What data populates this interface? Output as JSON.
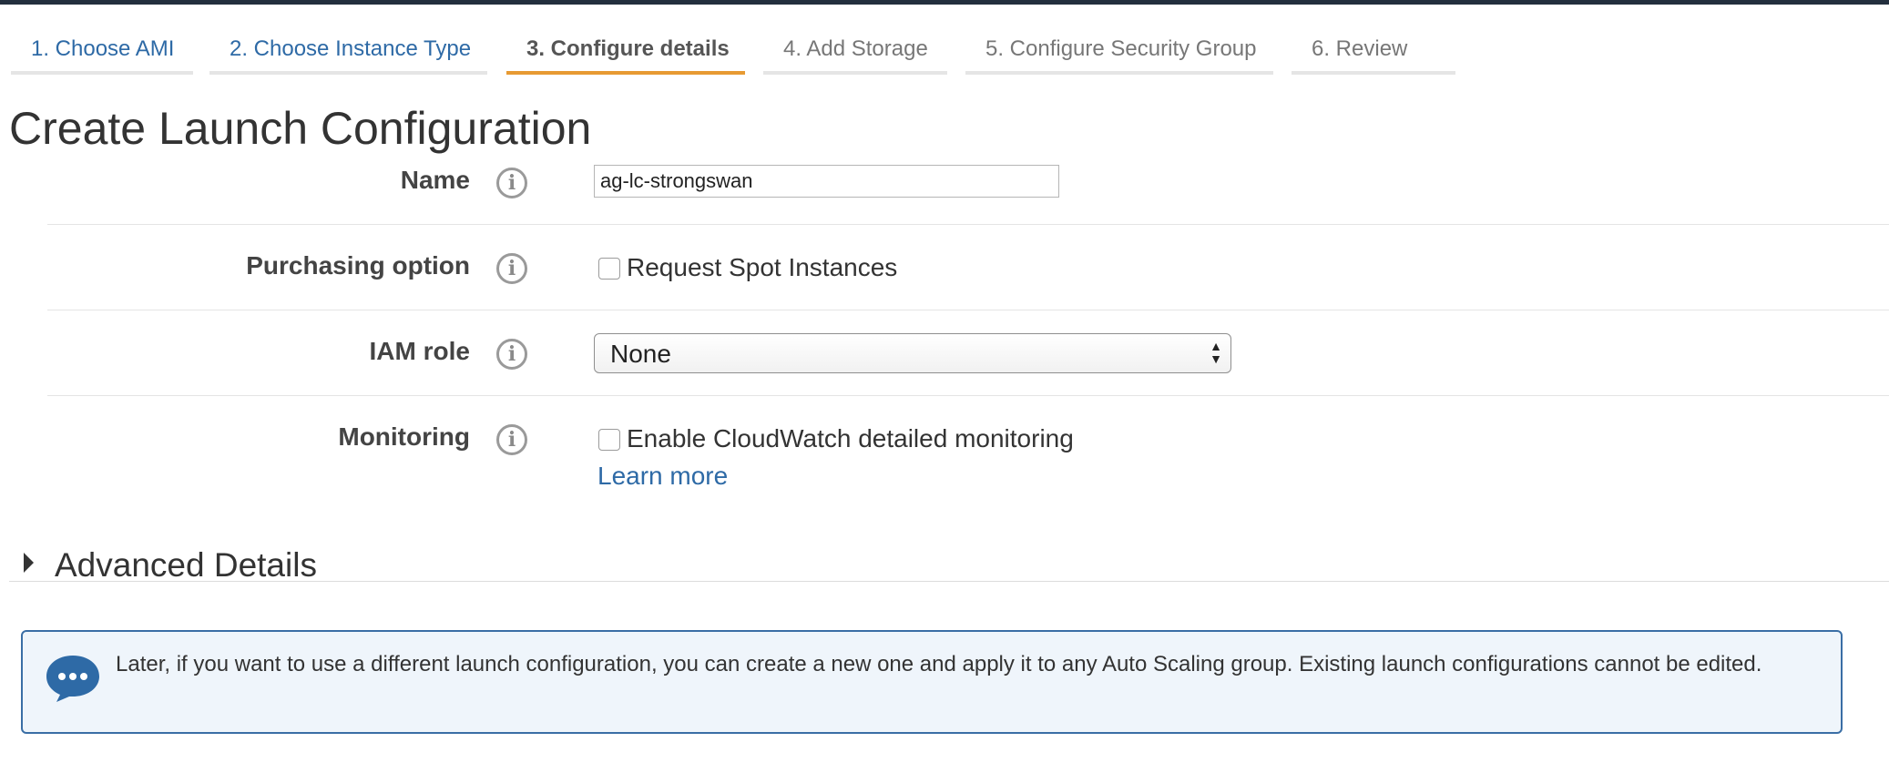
{
  "wizard": {
    "steps": [
      {
        "label": "1. Choose AMI",
        "state": "done"
      },
      {
        "label": "2. Choose Instance Type",
        "state": "done"
      },
      {
        "label": "3. Configure details",
        "state": "active"
      },
      {
        "label": "4. Add Storage",
        "state": "pending"
      },
      {
        "label": "5. Configure Security Group",
        "state": "pending"
      },
      {
        "label": "6. Review",
        "state": "pending"
      }
    ]
  },
  "page": {
    "title": "Create Launch Configuration"
  },
  "form": {
    "name": {
      "label": "Name",
      "value": "ag-lc-strongswan"
    },
    "purchasing": {
      "label": "Purchasing option",
      "checkbox_label": "Request Spot Instances",
      "checked": false
    },
    "iam_role": {
      "label": "IAM role",
      "selected": "None"
    },
    "monitoring": {
      "label": "Monitoring",
      "checkbox_label": "Enable CloudWatch detailed monitoring",
      "checked": false,
      "learn_more": "Learn more"
    }
  },
  "advanced": {
    "title": "Advanced Details",
    "expanded": false
  },
  "notice": {
    "text": "Later, if you want to use a different launch configuration, you can create a new one and apply it to any Auto Scaling group. Existing launch configurations cannot be edited.",
    "icon": "speech-bubble-icon"
  },
  "colors": {
    "link": "#2e6aa6",
    "active_tab_bar": "#e79a33",
    "notice_border": "#3a6ea5",
    "notice_bg": "#eff5fb"
  },
  "icons": {
    "info": "i"
  }
}
